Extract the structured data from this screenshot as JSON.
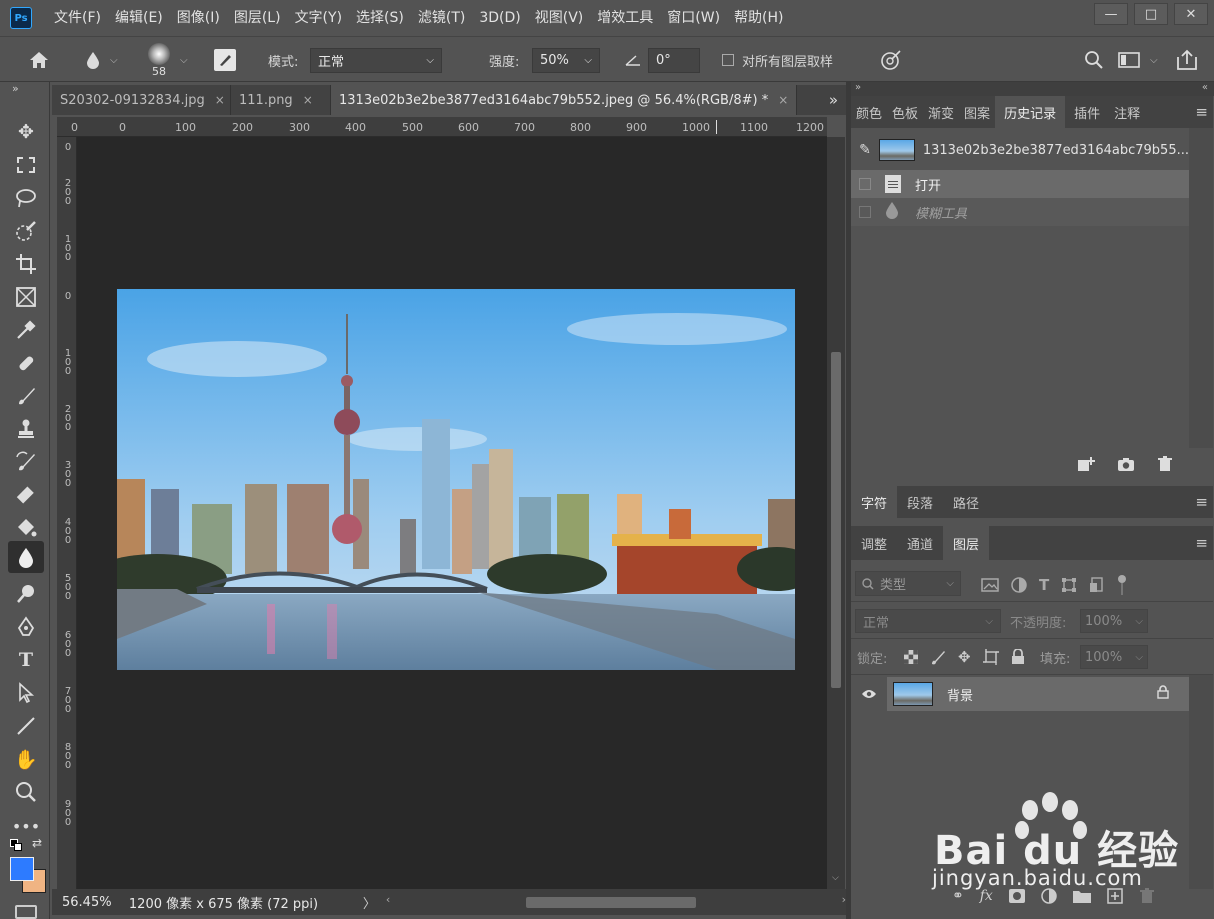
{
  "menubar": {
    "logo": "Ps",
    "items": [
      "文件(F)",
      "编辑(E)",
      "图像(I)",
      "图层(L)",
      "文字(Y)",
      "选择(S)",
      "滤镜(T)",
      "3D(D)",
      "视图(V)",
      "增效工具",
      "窗口(W)",
      "帮助(H)"
    ],
    "window_controls": [
      "—",
      "□",
      "✕"
    ]
  },
  "options": {
    "brush_size": "58",
    "mode_label": "模式:",
    "mode_value": "正常",
    "strength_label": "强度:",
    "strength_value": "50%",
    "angle_value": "0°",
    "sample_all_label": "对所有图层取样"
  },
  "tabs": {
    "items": [
      {
        "label": "S20302-09132834.jpg",
        "close": "×"
      },
      {
        "label": "111.png",
        "close": "×"
      },
      {
        "label": "1313e02b3e2be3877ed3164abc79b552.jpeg @ 56.4%(RGB/8#) *",
        "close": "×"
      }
    ],
    "overflow": "»"
  },
  "rulers": {
    "top": [
      "0",
      "0",
      "100",
      "200",
      "300",
      "400",
      "500",
      "600",
      "700",
      "800",
      "900",
      "1000",
      "1100",
      "1200"
    ],
    "left": [
      "0",
      "2 0 0",
      "1 0 0",
      "0",
      "1 0 0",
      "2 0 0",
      "3 0 0",
      "4 0 0",
      "5 0 0",
      "6 0 0",
      "7 0 0",
      "8 0 0",
      "9 0 0"
    ]
  },
  "status": {
    "zoom": "56.45%",
    "doc_info": "1200 像素 x 675 像素 (72 ppi)",
    "arrow": "〉"
  },
  "right_panels": {
    "top_tabs": [
      "颜色",
      "色板",
      "渐变",
      "图案",
      "历史记录",
      "插件",
      "注释"
    ],
    "history": {
      "snapshot": "1313e02b3e2be3877ed3164abc79b55...",
      "items": [
        {
          "label": "打开"
        },
        {
          "label": "模糊工具"
        }
      ]
    },
    "mid_tabs": [
      "字符",
      "段落",
      "路径"
    ],
    "layer_tabs": [
      "调整",
      "通道",
      "图层"
    ],
    "layers": {
      "filter_placeholder": "类型",
      "blend_mode": "正常",
      "opacity_label": "不透明度:",
      "opacity_value": "100%",
      "lock_label": "锁定:",
      "fill_label": "填充:",
      "fill_value": "100%",
      "items": [
        {
          "name": "背景"
        }
      ]
    }
  },
  "watermark": {
    "brand": "Bai du 经验",
    "url": "jingyan.baidu.com"
  },
  "colors": {
    "foreground": "#2d7bff",
    "background": "#f0b483",
    "accent": "#31a8ff"
  }
}
